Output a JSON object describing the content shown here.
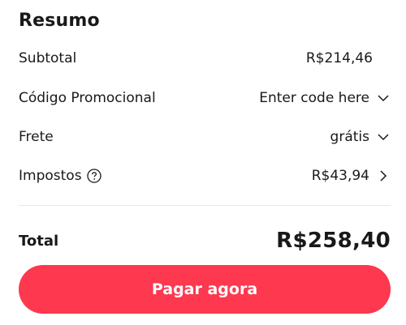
{
  "summary": {
    "title": "Resumo",
    "subtotal": {
      "label": "Subtotal",
      "value": "R$214,46"
    },
    "promo": {
      "label": "Código Promocional",
      "value": "Enter code here"
    },
    "shipping": {
      "label": "Frete",
      "value": "grátis"
    },
    "taxes": {
      "label": "Impostos",
      "value": "R$43,94"
    },
    "total": {
      "label": "Total",
      "value": "R$258,40"
    },
    "pay_button_label": "Pagar agora"
  },
  "colors": {
    "accent": "#fd384f",
    "text": "#191919",
    "divider": "#e8e8e8"
  },
  "icons": {
    "promo_toggle": "chevron-down-icon",
    "shipping_toggle": "chevron-down-icon",
    "taxes_expand": "chevron-right-icon",
    "taxes_help": "question-circle-icon"
  }
}
